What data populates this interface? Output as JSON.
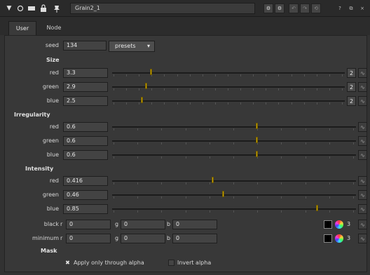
{
  "title": "Grain2_1",
  "tabs": [
    "User",
    "Node"
  ],
  "seed": {
    "label": "seed",
    "value": "134"
  },
  "presets": {
    "label": "presets",
    "arrow": "▾"
  },
  "sections": {
    "size": "Size",
    "irregularity": "Irregularity",
    "intensity": "Intensity",
    "mask": "Mask"
  },
  "size": [
    {
      "label": "red",
      "value": "3.3",
      "count": "2"
    },
    {
      "label": "green",
      "value": "2.9",
      "count": "2"
    },
    {
      "label": "blue",
      "value": "2.5",
      "count": "2"
    }
  ],
  "irregularity": [
    {
      "label": "red",
      "value": "0.6"
    },
    {
      "label": "green",
      "value": "0.6"
    },
    {
      "label": "blue",
      "value": "0.6"
    }
  ],
  "intensity": [
    {
      "label": "red",
      "value": "0.416"
    },
    {
      "label": "green",
      "value": "0.46"
    },
    {
      "label": "blue",
      "value": "0.85"
    }
  ],
  "black": {
    "label": "black",
    "r": "0",
    "g": "0",
    "b": "0",
    "count": "3"
  },
  "minimum": {
    "label": "minimum",
    "r": "0",
    "g": "0",
    "b": "0",
    "count": "3"
  },
  "channel_labels": {
    "r": "r",
    "g": "g",
    "b": "b"
  },
  "mask": {
    "apply_label": "Apply only through alpha",
    "invert_label": "Invert alpha",
    "apply_checked": true,
    "invert_checked": false
  },
  "colors": {
    "handle": "#c9a400",
    "background": "#323232",
    "panel": "#383838"
  }
}
